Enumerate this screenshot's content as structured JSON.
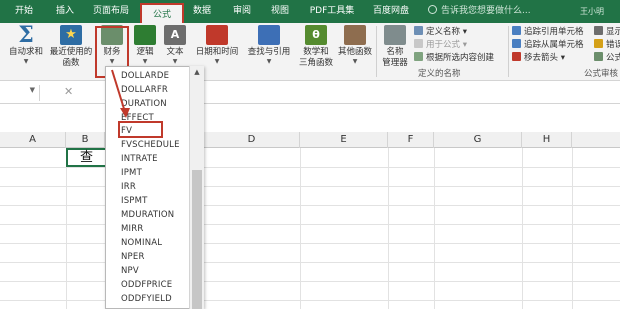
{
  "ribbon_tabs": {
    "home": "开始",
    "insert": "插入",
    "page_layout": "页面布局",
    "formulas": "公式",
    "data": "数据",
    "review": "审阅",
    "view": "视图",
    "pdf_tools": "PDF工具集",
    "baidu_pan": "百度网盘",
    "tell_me": "告诉我您想要做什么...",
    "account": "王小明   Excel"
  },
  "function_library": {
    "autosum": "自动求和",
    "recently_used_line1": "最近使用的",
    "recently_used_line2": "函数",
    "financial": "财务",
    "logical": "逻辑",
    "text": "文本",
    "date_time": "日期和时间",
    "lookup_reference": "查找与引用",
    "math_trig_line1": "数学和",
    "math_trig_line2": "三角函数",
    "more_functions": "其他函数"
  },
  "defined_names": {
    "name_manager_line1": "名称",
    "name_manager_line2": "管理器",
    "define_name": "定义名称",
    "use_in_formula": "用于公式",
    "create_from_selection": "根据所选内容创建",
    "group_label": "定义的名称"
  },
  "formula_auditing": {
    "trace_precedents": "追踪引用单元格",
    "trace_dependents": "追踪从属单元格",
    "remove_arrows": "移去箭头",
    "show_formulas": "显示",
    "error_checking": "错误",
    "evaluate": "公式",
    "group_label": "公式审核"
  },
  "formula_bar": {
    "cancel_symbol": "✕",
    "content": ""
  },
  "columns": [
    "A",
    "B",
    "C",
    "D",
    "E",
    "F",
    "G",
    "H"
  ],
  "active_cell_text": "查",
  "financial_dropdown": {
    "items": [
      "DOLLARDE",
      "DOLLARFR",
      "DURATION",
      "EFFECT",
      "FV",
      "FVSCHEDULE",
      "INTRATE",
      "IPMT",
      "IRR",
      "ISPMT",
      "MDURATION",
      "MIRR",
      "NOMINAL",
      "NPER",
      "NPV",
      "ODDFPRICE",
      "ODDFYIELD"
    ],
    "highlighted": "FV"
  },
  "colors": {
    "ribbon_green": "#217346",
    "highlight_red": "#c0392b"
  }
}
